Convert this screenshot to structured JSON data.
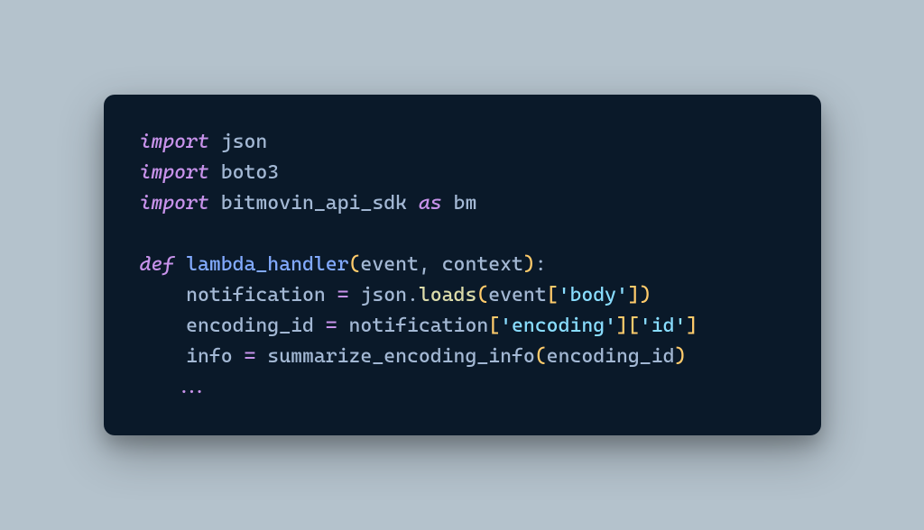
{
  "code": {
    "line1": {
      "kw": "import",
      "mod": "json"
    },
    "line2": {
      "kw": "import",
      "mod": "boto3"
    },
    "line3": {
      "kw": "import",
      "mod": "bitmovin_api_sdk",
      "as": "as",
      "alias": "bm"
    },
    "line5": {
      "def": "def",
      "name": "lambda_handler",
      "p1": "event",
      "p2": "context"
    },
    "line6": {
      "var": "notification",
      "eq": "=",
      "obj": "json",
      "method": "loads",
      "arg": "event",
      "str": "'body'"
    },
    "line7": {
      "var": "encoding_id",
      "eq": "=",
      "obj": "notification",
      "str1": "'encoding'",
      "str2": "'id'"
    },
    "line8": {
      "var": "info",
      "eq": "=",
      "fn": "summarize_encoding_info",
      "arg": "encoding_id"
    },
    "line9": {
      "dots": "..."
    }
  }
}
